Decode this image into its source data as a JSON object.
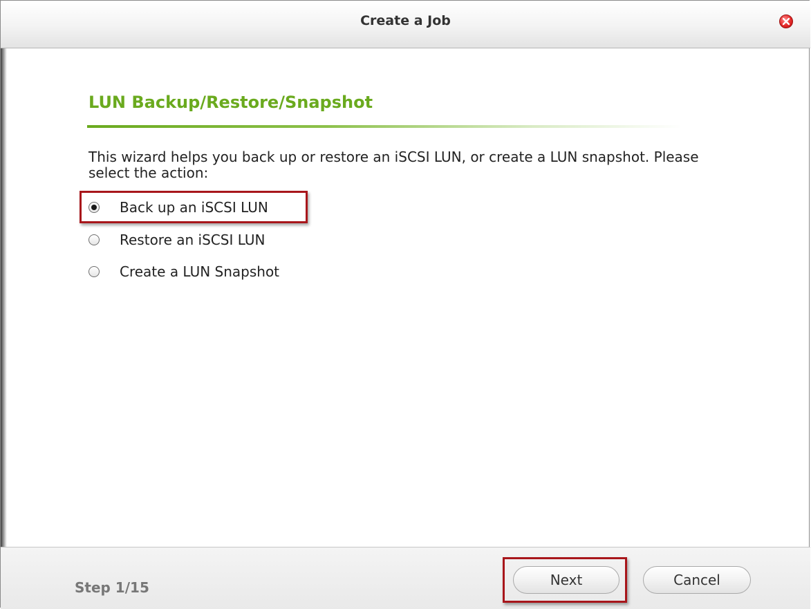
{
  "dialog": {
    "title": "Create a Job",
    "close_icon": "close-icon"
  },
  "wizard": {
    "section_title": "LUN Backup/Restore/Snapshot",
    "description": "This wizard helps you back up or restore an iSCSI LUN, or create a LUN snapshot. Please select the action:",
    "options": [
      {
        "label": "Back up an iSCSI LUN",
        "selected": true
      },
      {
        "label": "Restore an iSCSI LUN",
        "selected": false
      },
      {
        "label": "Create a LUN Snapshot",
        "selected": false
      }
    ]
  },
  "footer": {
    "step": "Step 1/15",
    "next_label": "Next",
    "cancel_label": "Cancel"
  },
  "colors": {
    "accent": "#6aaa1e",
    "highlight": "#a8161b",
    "close": "#e52a2a"
  }
}
